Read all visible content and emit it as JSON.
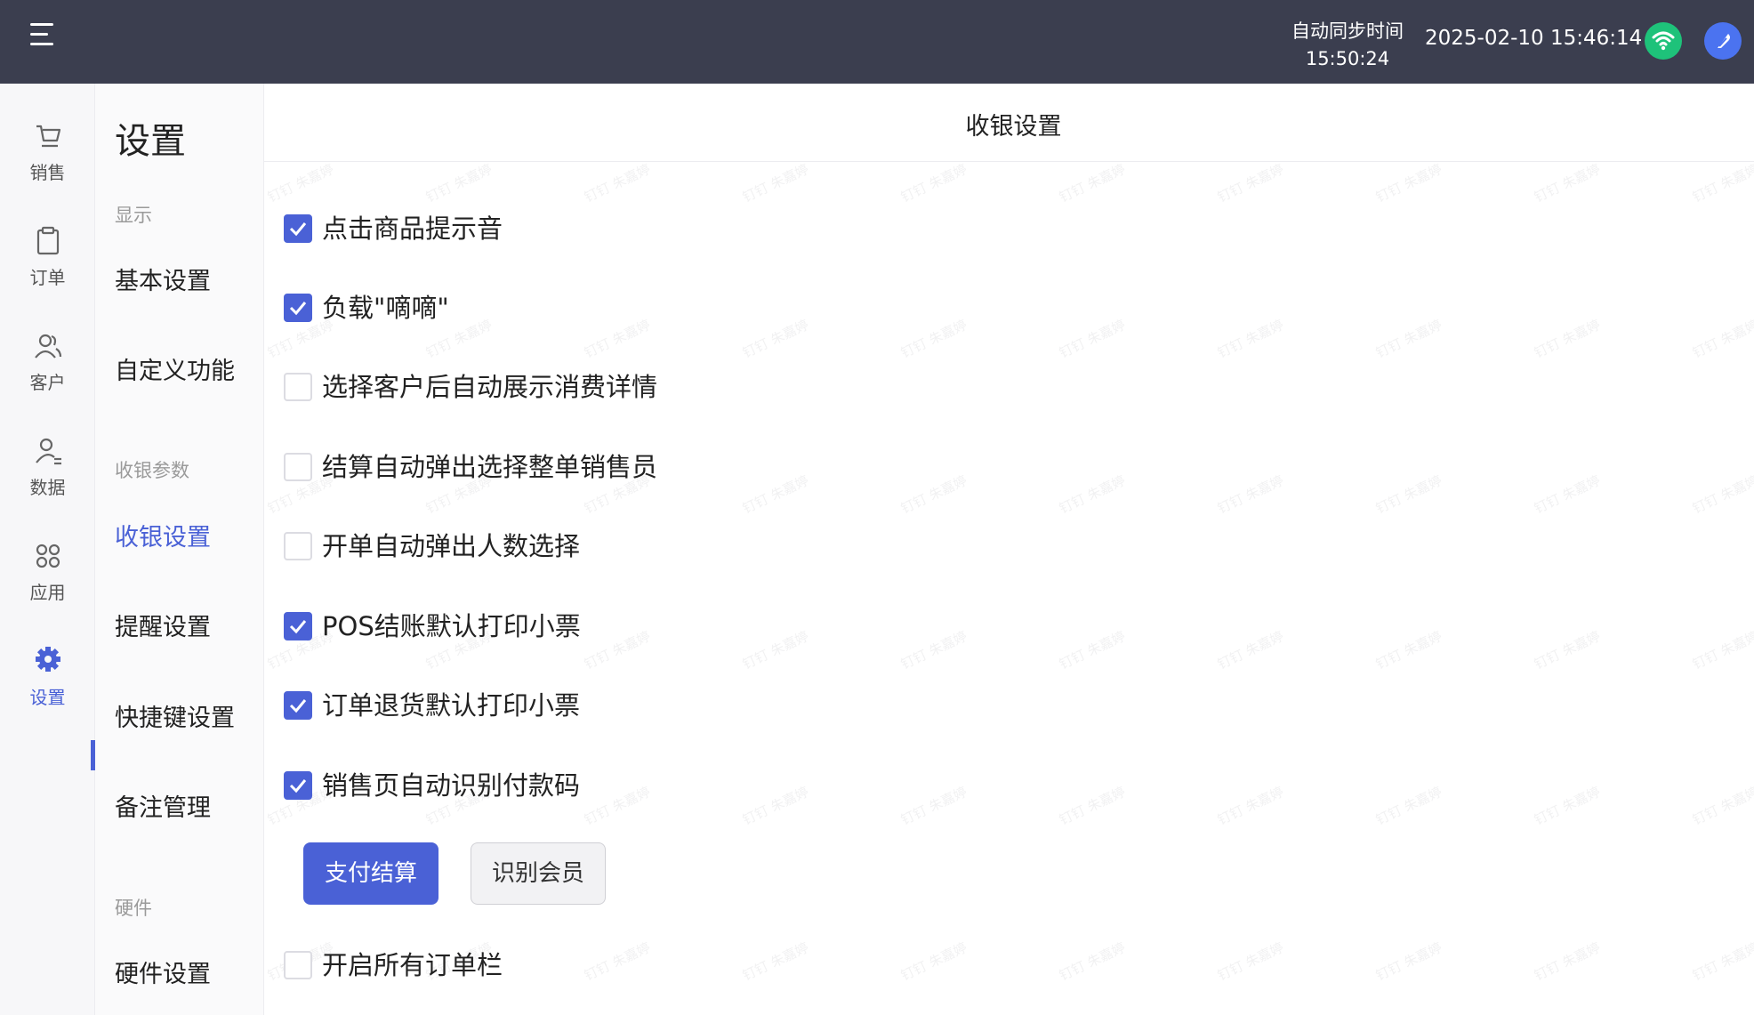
{
  "topbar": {
    "sync_label": "自动同步时间",
    "sync_time": "15:50:24",
    "datetime": "2025-02-10 15:46:14"
  },
  "rail": {
    "items": [
      {
        "label": "销售",
        "icon": "cart-icon"
      },
      {
        "label": "订单",
        "icon": "clipboard-icon"
      },
      {
        "label": "客户",
        "icon": "users-icon"
      },
      {
        "label": "数据",
        "icon": "user-data-icon"
      },
      {
        "label": "应用",
        "icon": "apps-grid-icon"
      },
      {
        "label": "设置",
        "icon": "gear-icon"
      }
    ],
    "active_index": 5
  },
  "menu": {
    "title": "设置",
    "groups": {
      "display": "显示",
      "cashier_params": "收银参数",
      "hardware": "硬件"
    },
    "items": {
      "basic": "基本设置",
      "custom": "自定义功能",
      "cashier": "收银设置",
      "reminder": "提醒设置",
      "shortcut": "快捷键设置",
      "notes": "备注管理",
      "hardware": "硬件设置"
    }
  },
  "main": {
    "title": "收银设置",
    "options": [
      {
        "label": "点击商品提示音",
        "checked": true
      },
      {
        "label": "负载\"嘀嘀\"",
        "checked": true
      },
      {
        "label": "选择客户后自动展示消费详情",
        "checked": false
      },
      {
        "label": "结算自动弹出选择整单销售员",
        "checked": false
      },
      {
        "label": "开单自动弹出人数选择",
        "checked": false
      },
      {
        "label": "POS结账默认打印小票",
        "checked": true
      },
      {
        "label": "订单退货默认打印小票",
        "checked": true
      },
      {
        "label": "销售页自动识别付款码",
        "checked": true
      },
      {
        "label": "开启所有订单栏",
        "checked": false
      }
    ],
    "buttons": {
      "pay": "支付结算",
      "member": "识别会员"
    }
  },
  "colors": {
    "accent": "#4a61d6",
    "topbar": "#3b3e4f",
    "wifi": "#1ec27a"
  },
  "watermark": "钉钉 朱嘉婷"
}
